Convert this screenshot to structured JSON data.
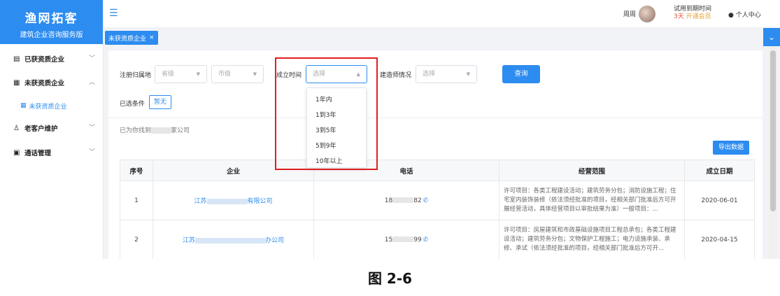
{
  "app": {
    "title": "渔网拓客",
    "subtitle": "建筑企业咨询服务版"
  },
  "sidebar": {
    "items": [
      {
        "label": "已获资质企业",
        "icon": "document-icon",
        "expanded": false
      },
      {
        "label": "未获资质企业",
        "icon": "building-icon",
        "expanded": true
      },
      {
        "label": "未获资质企业",
        "icon": "building-icon",
        "sub": true,
        "active": true
      },
      {
        "label": "老客户维护",
        "icon": "user-icon",
        "expanded": false
      },
      {
        "label": "通话管理",
        "icon": "list-icon",
        "expanded": false
      }
    ]
  },
  "header": {
    "user_name": "周周",
    "trial_label": "试用到期时间",
    "trial_days": "3天",
    "trial_vip": "开通会员",
    "personal_center": "个人中心"
  },
  "tabs": [
    {
      "label": "未获资质企业",
      "close": "×"
    }
  ],
  "filters": {
    "region_label": "注册归属地",
    "province_placeholder": "省级",
    "city_placeholder": "市级",
    "founded_label": "成立时间",
    "founded_placeholder": "选择",
    "builder_label": "建造师情况",
    "builder_placeholder": "选择",
    "query_button": "查询",
    "selected_label": "已选条件",
    "selected_value": "暂无"
  },
  "dropdown": {
    "options": [
      "1年内",
      "1到3年",
      "3到5年",
      "5到9年",
      "10年以上"
    ]
  },
  "results": {
    "found_prefix": "已为你找到",
    "found_suffix": "家公司",
    "export_button": "导出数据"
  },
  "table": {
    "headers": [
      "序号",
      "企业",
      "电话",
      "经营范围",
      "成立日期"
    ],
    "rows": [
      {
        "index": "1",
        "company_prefix": "江苏",
        "company_suffix": "有限公司",
        "phone_prefix": "18",
        "phone_suffix": "82",
        "scope": "许可项目：各类工程建设活动；建筑劳务分包；消防设施工程；住宅室内装饰装修（依法须经批准的项目，经相关部门批准后方可开展经营活动，具体经营项目以审批结果为准）一般项目：...",
        "date": "2020-06-01"
      },
      {
        "index": "2",
        "company_prefix": "江苏",
        "company_suffix": "办公司",
        "phone_prefix": "15",
        "phone_suffix": "99",
        "scope": "许可项目：房屋建筑和市政基础设施项目工程总承包；各类工程建设活动；建筑劳务分包；文物保护工程施工；电力设施承装、承修、承试（依法须经批准的项目，经相关部门批准后方可开...",
        "date": "2020-04-15"
      }
    ]
  },
  "caption": "图 2-6",
  "colors": {
    "primary": "#2d8cf0",
    "highlight": "#e02020",
    "trial_red": "#e74c3c"
  }
}
